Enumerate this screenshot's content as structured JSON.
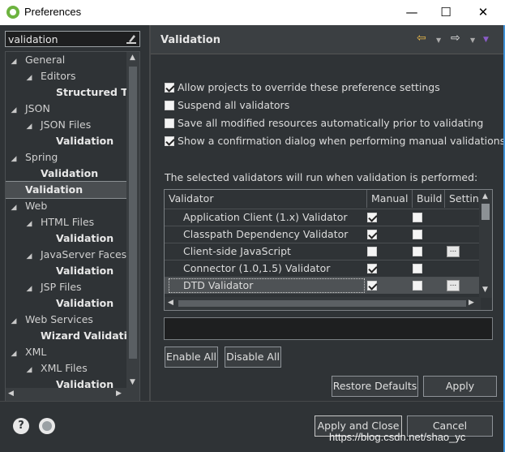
{
  "window": {
    "title": "Preferences",
    "minimize": "—",
    "maximize": "☐",
    "close": "✕"
  },
  "filter": {
    "value": "validation"
  },
  "tree": [
    {
      "label": "General",
      "indent": 0,
      "arrow": "◢",
      "bold": false
    },
    {
      "label": "Editors",
      "indent": 1,
      "arrow": "◢",
      "bold": false
    },
    {
      "label": "Structured Text Editors",
      "indent": 2,
      "arrow": "",
      "bold": true
    },
    {
      "label": "JSON",
      "indent": 0,
      "arrow": "◢",
      "bold": false
    },
    {
      "label": "JSON Files",
      "indent": 1,
      "arrow": "◢",
      "bold": false
    },
    {
      "label": "Validation",
      "indent": 2,
      "arrow": "",
      "bold": true
    },
    {
      "label": "Spring",
      "indent": 0,
      "arrow": "◢",
      "bold": false
    },
    {
      "label": "Validation",
      "indent": 1,
      "arrow": "",
      "bold": true
    },
    {
      "label": "Validation",
      "indent": 0,
      "arrow": "",
      "bold": true,
      "selected": true
    },
    {
      "label": "Web",
      "indent": 0,
      "arrow": "◢",
      "bold": false
    },
    {
      "label": "HTML Files",
      "indent": 1,
      "arrow": "◢",
      "bold": false
    },
    {
      "label": "Validation",
      "indent": 2,
      "arrow": "",
      "bold": true
    },
    {
      "label": "JavaServer Faces Tools",
      "indent": 1,
      "arrow": "◢",
      "bold": false
    },
    {
      "label": "Validation",
      "indent": 2,
      "arrow": "",
      "bold": true
    },
    {
      "label": "JSP Files",
      "indent": 1,
      "arrow": "◢",
      "bold": false
    },
    {
      "label": "Validation",
      "indent": 2,
      "arrow": "",
      "bold": true
    },
    {
      "label": "Web Services",
      "indent": 0,
      "arrow": "◢",
      "bold": false
    },
    {
      "label": "Wizard Validation",
      "indent": 1,
      "arrow": "",
      "bold": true
    },
    {
      "label": "XML",
      "indent": 0,
      "arrow": "◢",
      "bold": false
    },
    {
      "label": "XML Files",
      "indent": 1,
      "arrow": "◢",
      "bold": false
    },
    {
      "label": "Validation",
      "indent": 2,
      "arrow": "",
      "bold": true
    }
  ],
  "page": {
    "title": "Validation",
    "back_icon": "⇦",
    "forward_icon": "⇨"
  },
  "options": [
    {
      "label": "Allow projects to override these preference settings",
      "checked": true
    },
    {
      "label": "Suspend all validators",
      "checked": false
    },
    {
      "label": "Save all modified resources automatically prior to validating",
      "checked": false
    },
    {
      "label": "Show a confirmation dialog when performing manual validations",
      "checked": true
    }
  ],
  "info_text": "The selected validators will run when validation is performed:",
  "table": {
    "headers": [
      "Validator",
      "Manual",
      "Build",
      "Settings"
    ],
    "rows": [
      {
        "name": "Application Client (1.x) Validator",
        "manual": true,
        "build": false,
        "settings": false
      },
      {
        "name": "Classpath Dependency Validator",
        "manual": true,
        "build": false,
        "settings": false
      },
      {
        "name": "Client-side JavaScript",
        "manual": false,
        "build": false,
        "settings": true
      },
      {
        "name": "Connector (1.0,1.5) Validator",
        "manual": true,
        "build": false,
        "settings": false
      },
      {
        "name": "DTD Validator",
        "manual": true,
        "build": false,
        "settings": true,
        "selected": true
      }
    ],
    "settings_label": "..."
  },
  "buttons": {
    "enable_all": "Enable All",
    "disable_all": "Disable All",
    "restore_defaults": "Restore Defaults",
    "apply": "Apply",
    "apply_and_close": "Apply and Close",
    "cancel": "Cancel"
  },
  "footer": {
    "help_icon": "?",
    "watermark": "https://blog.csdn.net/shao_yc"
  }
}
